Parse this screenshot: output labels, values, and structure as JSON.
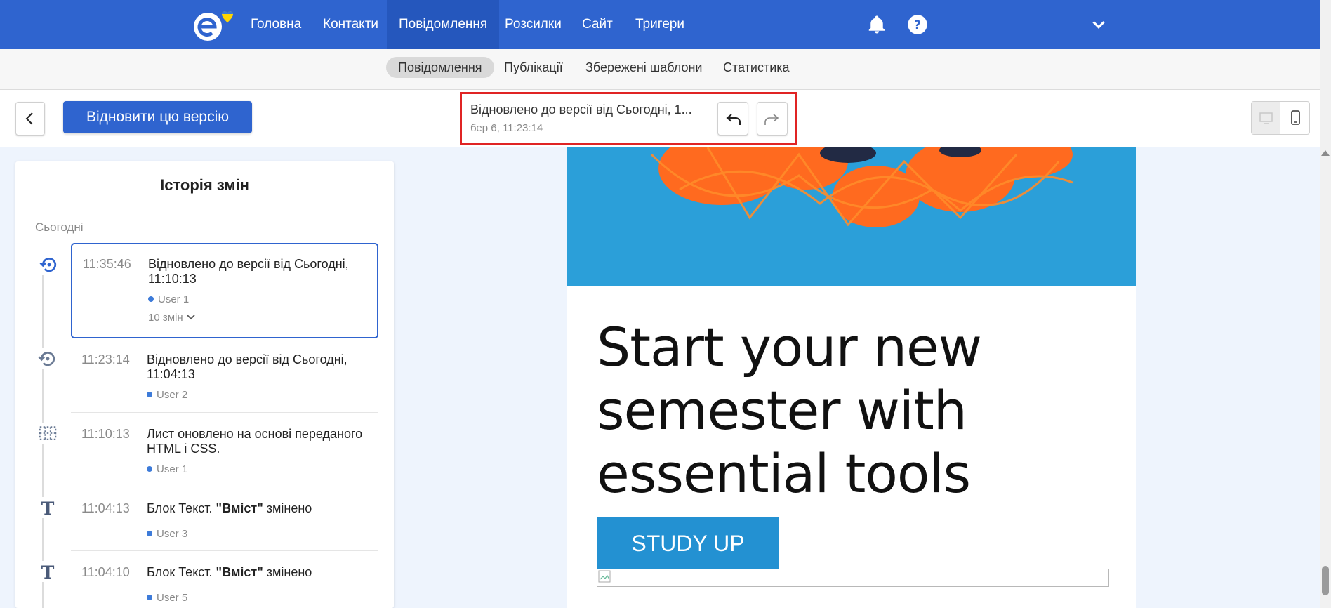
{
  "nav": {
    "items": [
      {
        "label": "Головна"
      },
      {
        "label": "Контакти"
      },
      {
        "label": "Повідомлення",
        "active": true
      },
      {
        "label": "Розсилки"
      },
      {
        "label": "Сайт"
      },
      {
        "label": "Тригери"
      }
    ],
    "icons": [
      "bell-icon",
      "help-icon",
      "chevron-down-icon"
    ]
  },
  "subnav": {
    "items": [
      {
        "label": "Повідомлення",
        "active": true
      },
      {
        "label": "Публікації"
      },
      {
        "label": "Збережені шаблони"
      },
      {
        "label": "Статистика"
      }
    ]
  },
  "toolbar": {
    "restore_label": "Відновити цю версію",
    "version_title": "Відновлено до версії від Сьогодні, 1...",
    "version_date": "бер 6, 11:23:14"
  },
  "history": {
    "title": "Історія змін",
    "group_label": "Сьогодні",
    "entries": [
      {
        "time": "11:35:46",
        "text": "Відновлено до версії від Сьогодні, 11:10:13",
        "user": "User 1",
        "changes": "10 змін",
        "icon": "restore-icon",
        "selected": true
      },
      {
        "time": "11:23:14",
        "text": "Відновлено до версії від Сьогодні, 11:04:13",
        "user": "User 2",
        "icon": "restore-icon"
      },
      {
        "time": "11:10:13",
        "text": "Лист оновлено на основі переданого HTML і CSS.",
        "user": "User 1",
        "icon": "html-grid-icon"
      },
      {
        "time": "11:04:13",
        "text_prefix": "Блок Текст. ",
        "text_bold": "\"Вміст\"",
        "text_suffix": " змінено",
        "user": "User 3",
        "icon": "text-icon"
      },
      {
        "time": "11:04:10",
        "text_prefix": "Блок Текст. ",
        "text_bold": "\"Вміст\"",
        "text_suffix": " змінено",
        "user": "User 5",
        "icon": "text-icon"
      }
    ]
  },
  "preview": {
    "headline": "Start your new semester with essential tools",
    "cta_label": "STUDY UP"
  },
  "colors": {
    "brand": "#2f64cf",
    "highlight_border": "#e02424",
    "cta": "#2391d2"
  }
}
